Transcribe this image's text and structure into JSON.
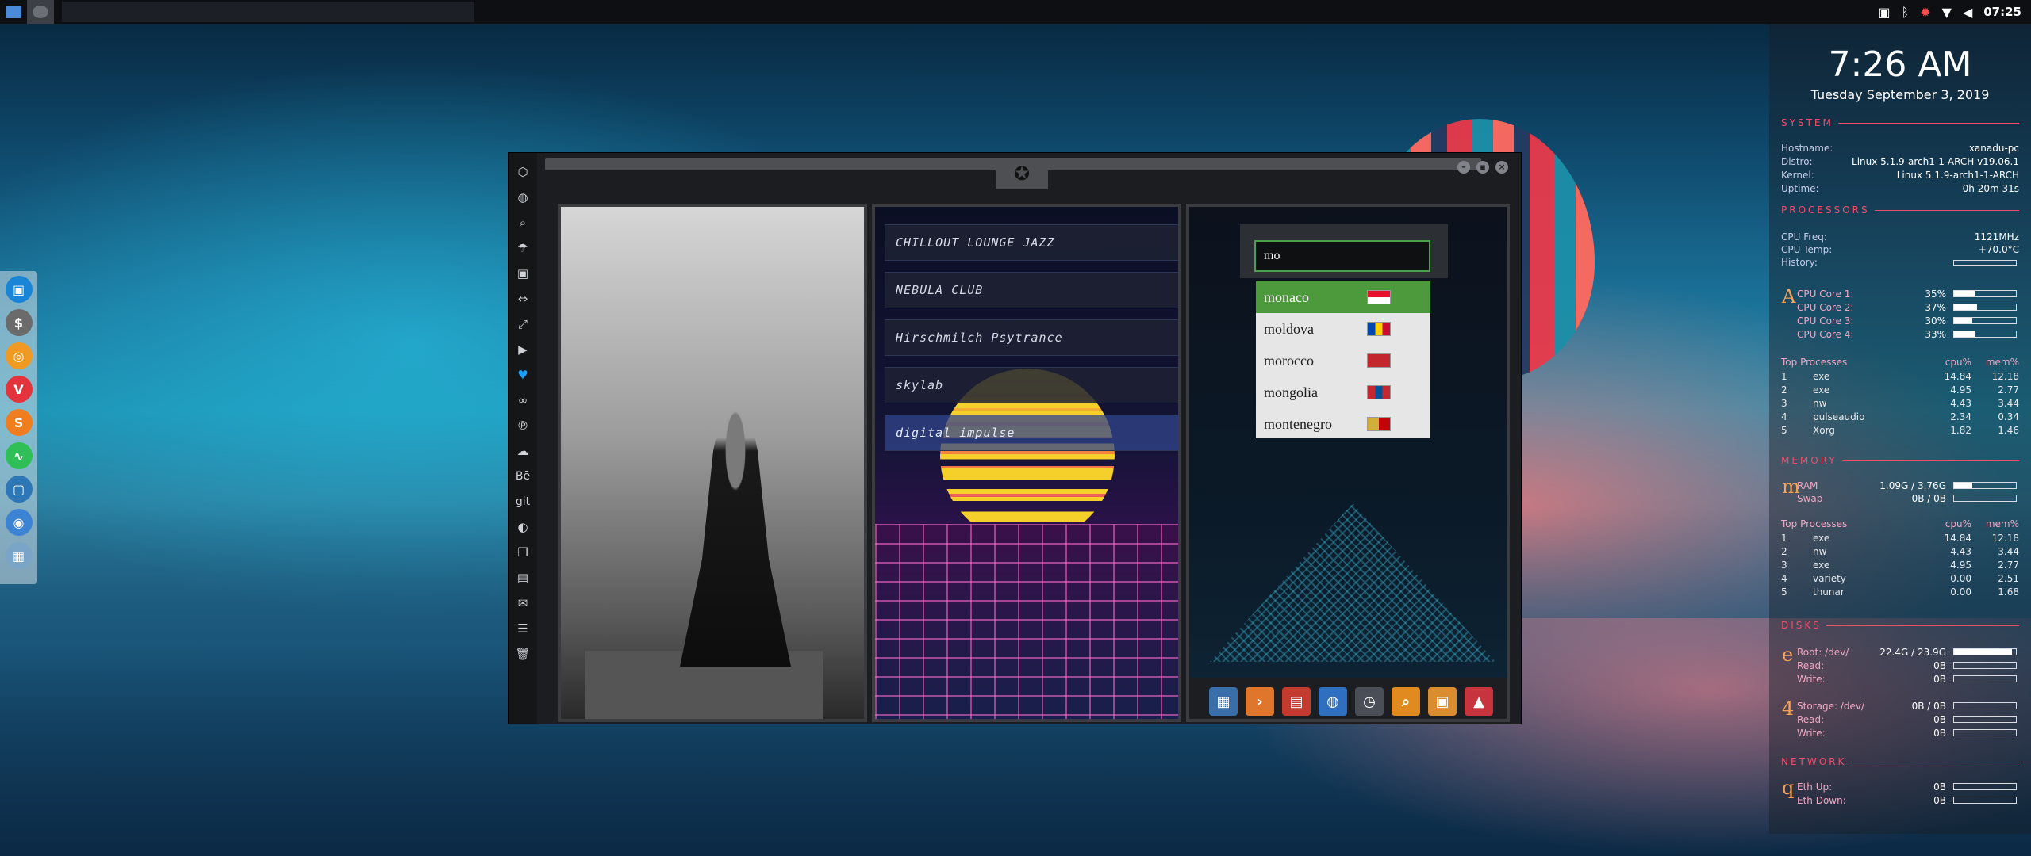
{
  "topbar": {
    "time": "07:25",
    "tray_icons": [
      "screenshot-icon",
      "bluetooth-icon",
      "settings-red-icon",
      "wifi-icon",
      "volume-icon"
    ]
  },
  "dock": {
    "apps": [
      {
        "name": "file-manager-icon",
        "glyph": "▣",
        "color": "#1a85d6"
      },
      {
        "name": "terminal-icon",
        "glyph": "$",
        "color": "#6b6b6b"
      },
      {
        "name": "ubuntu-icon",
        "glyph": "◎",
        "color": "#f09a23"
      },
      {
        "name": "vivaldi-icon",
        "glyph": "V",
        "color": "#e3343d"
      },
      {
        "name": "sublime-icon",
        "glyph": "S",
        "color": "#f07d1e"
      },
      {
        "name": "monitor-icon",
        "glyph": "∿",
        "color": "#2fbf56"
      },
      {
        "name": "screenshot-icon",
        "glyph": "▢",
        "color": "#2e77b6"
      },
      {
        "name": "chrome-icon",
        "glyph": "◉",
        "color": "#3c83d4"
      },
      {
        "name": "grid-icon",
        "glyph": "▦",
        "color": "#7aa5c7"
      }
    ]
  },
  "window": {
    "emblem": "✪",
    "sidebar": [
      {
        "name": "settings-icon",
        "glyph": "⬡"
      },
      {
        "name": "globe-icon",
        "glyph": "◍"
      },
      {
        "name": "search-icon",
        "glyph": "⌕"
      },
      {
        "name": "umbrella-icon",
        "glyph": "☂"
      },
      {
        "name": "contact-icon",
        "glyph": "▣"
      },
      {
        "name": "code-icon",
        "glyph": "⇔"
      },
      {
        "name": "expand-icon",
        "glyph": "⤢"
      },
      {
        "name": "youtube-icon",
        "glyph": "▶"
      },
      {
        "name": "heart-icon",
        "glyph": "♥"
      },
      {
        "name": "creative-cloud-icon",
        "glyph": "∞"
      },
      {
        "name": "pinterest-icon",
        "glyph": "℗"
      },
      {
        "name": "cloud-icon",
        "glyph": "☁"
      },
      {
        "name": "behance-icon",
        "glyph": "Bē"
      },
      {
        "name": "git-icon",
        "glyph": "git"
      },
      {
        "name": "github-icon",
        "glyph": "◐"
      },
      {
        "name": "cubes-icon",
        "glyph": "❒"
      },
      {
        "name": "map-icon",
        "glyph": "▤"
      },
      {
        "name": "mail-icon",
        "glyph": "✉"
      },
      {
        "name": "server-icon",
        "glyph": "☰"
      },
      {
        "name": "trash-icon",
        "glyph": "🗑"
      }
    ],
    "stations": [
      "CHILLOUT LOUNGE JAZZ",
      "NEBULA CLUB",
      "Hirschmilch Psytrance",
      "skylab",
      "digital impulse"
    ],
    "search_value": "mo",
    "suggestions": [
      {
        "label": "monaco",
        "flag": [
          "#e8112d",
          "#ffffff"
        ]
      },
      {
        "label": "moldova",
        "flag": [
          "#0046ae",
          "#ffd200",
          "#cc092f"
        ]
      },
      {
        "label": "morocco",
        "flag": [
          "#c1272d"
        ]
      },
      {
        "label": "mongolia",
        "flag": [
          "#c4272f",
          "#015197",
          "#c4272f"
        ]
      },
      {
        "label": "montenegro",
        "flag": [
          "#d3ae3b",
          "#c40308"
        ]
      }
    ],
    "launcher": [
      {
        "name": "calculator-icon",
        "glyph": "▦",
        "color": "#3a6ea8"
      },
      {
        "name": "terminal-launch-icon",
        "glyph": "›",
        "color": "#e0762b"
      },
      {
        "name": "calendar-icon",
        "glyph": "▤",
        "color": "#c33a2e"
      },
      {
        "name": "browser-icon",
        "glyph": "◍",
        "color": "#2f6fbf"
      },
      {
        "name": "clock-icon",
        "glyph": "◷",
        "color": "#4a4f57"
      },
      {
        "name": "search-launch-icon",
        "glyph": "⌕",
        "color": "#e08a1f"
      },
      {
        "name": "image-icon",
        "glyph": "▣",
        "color": "#d98d2e"
      },
      {
        "name": "arch-icon",
        "glyph": "▲",
        "color": "#c8343d"
      }
    ]
  },
  "conky": {
    "time": "7:26 AM",
    "date": "Tuesday September  3, 2019",
    "system": {
      "title": "SYSTEM",
      "rows": [
        {
          "k": "Hostname:",
          "v": "xanadu-pc"
        },
        {
          "k": "Distro:",
          "v": "Linux 5.1.9-arch1-1-ARCH v19.06.1"
        },
        {
          "k": "Kernel:",
          "v": "Linux 5.1.9-arch1-1-ARCH"
        },
        {
          "k": "Uptime:",
          "v": "0h 20m 31s"
        }
      ]
    },
    "processors": {
      "title": "PROCESSORS",
      "freq_k": "CPU Freq:",
      "freq_v": "1121MHz",
      "temp_k": "CPU Temp:",
      "temp_v": "+70.0°C",
      "history_k": "History:",
      "letter": "A",
      "cores": [
        {
          "k": "CPU Core 1:",
          "v": "35%",
          "level": 0.35
        },
        {
          "k": "CPU Core 2:",
          "v": "37%",
          "level": 0.37
        },
        {
          "k": "CPU Core 3:",
          "v": "30%",
          "level": 0.3
        },
        {
          "k": "CPU Core 4:",
          "v": "33%",
          "level": 0.33
        }
      ],
      "top_title": "Top Processes",
      "cpu_col": "cpu%",
      "mem_col": "mem%",
      "top": [
        {
          "n": "1",
          "name": "exe",
          "c": "14.84",
          "m": "12.18"
        },
        {
          "n": "2",
          "name": "exe",
          "c": "4.95",
          "m": "2.77"
        },
        {
          "n": "3",
          "name": "nw",
          "c": "4.43",
          "m": "3.44"
        },
        {
          "n": "4",
          "name": "pulseaudio",
          "c": "2.34",
          "m": "0.34"
        },
        {
          "n": "5",
          "name": "Xorg",
          "c": "1.82",
          "m": "1.46"
        }
      ]
    },
    "memory": {
      "title": "MEMORY",
      "letter": "m",
      "ram_k": "RAM",
      "ram_v": "1.09G / 3.76G",
      "ram_level": 0.29,
      "swap_k": "Swap",
      "swap_v": "0B / 0B",
      "swap_level": 0,
      "top_title": "Top Processes",
      "cpu_col": "cpu%",
      "mem_col": "mem%",
      "top": [
        {
          "n": "1",
          "name": "exe",
          "c": "14.84",
          "m": "12.18"
        },
        {
          "n": "2",
          "name": "nw",
          "c": "4.43",
          "m": "3.44"
        },
        {
          "n": "3",
          "name": "exe",
          "c": "4.95",
          "m": "2.77"
        },
        {
          "n": "4",
          "name": "variety",
          "c": "0.00",
          "m": "2.51"
        },
        {
          "n": "5",
          "name": "thunar",
          "c": "0.00",
          "m": "1.68"
        }
      ]
    },
    "disks": {
      "title": "DISKS",
      "groups": [
        {
          "letter": "e",
          "rows": [
            {
              "k": "Root: /dev/",
              "v": "22.4G / 23.9G",
              "level": 0.94
            },
            {
              "k": "Read:",
              "v": "0B",
              "level": 0
            },
            {
              "k": "Write:",
              "v": "0B",
              "level": 0
            }
          ]
        },
        {
          "letter": "4",
          "rows": [
            {
              "k": "Storage: /dev/",
              "v": "0B / 0B",
              "level": 0
            },
            {
              "k": "Read:",
              "v": "0B",
              "level": 0
            },
            {
              "k": "Write:",
              "v": "0B",
              "level": 0
            }
          ]
        }
      ]
    },
    "network": {
      "title": "NETWORK",
      "letter": "q",
      "rows": [
        {
          "k": "Eth Up:",
          "v": "0B",
          "level": 0
        },
        {
          "k": "Eth Down:",
          "v": "0B",
          "level": 0
        }
      ]
    }
  }
}
